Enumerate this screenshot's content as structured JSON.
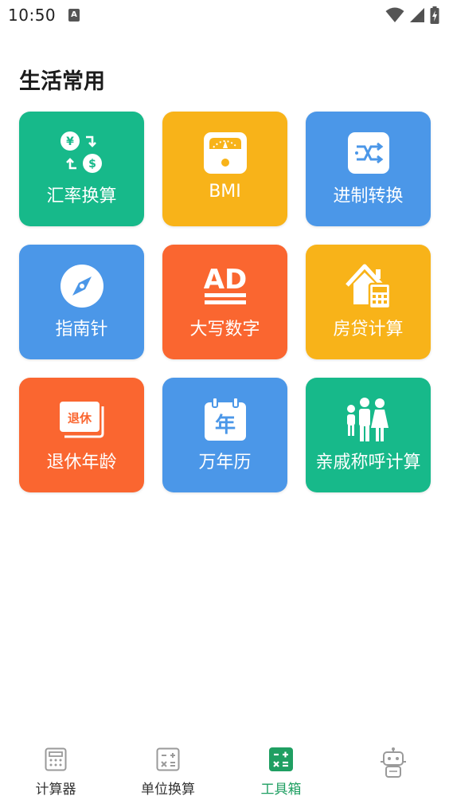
{
  "status_bar": {
    "time": "10:50",
    "notification_letter": "A"
  },
  "section": {
    "title": "生活常用"
  },
  "tools": [
    {
      "label": "汇率换算",
      "icon": "currency-exchange-icon",
      "color": "#17b98a"
    },
    {
      "label": "BMI",
      "icon": "scale-icon",
      "color": "#f8b319"
    },
    {
      "label": "进制转换",
      "icon": "base-convert-icon",
      "color": "#4b97e8"
    },
    {
      "label": "指南针",
      "icon": "compass-icon",
      "color": "#4b97e8"
    },
    {
      "label": "大写数字",
      "icon": "ad-uppercase-icon",
      "color": "#fa6630"
    },
    {
      "label": "房贷计算",
      "icon": "house-calculator-icon",
      "color": "#f8b319"
    },
    {
      "label": "退休年龄",
      "icon": "retirement-card-icon",
      "color": "#fa6630",
      "icon_text": "退休"
    },
    {
      "label": "万年历",
      "icon": "calendar-icon",
      "color": "#4b97e8",
      "icon_text": "年"
    },
    {
      "label": "亲戚称呼计算",
      "icon": "family-icon",
      "color": "#17b98a"
    }
  ],
  "bottom_nav": [
    {
      "label": "计算器",
      "icon": "calculator-icon",
      "active": false
    },
    {
      "label": "单位换算",
      "icon": "unit-convert-icon",
      "active": false
    },
    {
      "label": "工具箱",
      "icon": "toolbox-icon",
      "active": true
    },
    {
      "label": "",
      "icon": "robot-icon",
      "active": false
    }
  ],
  "colors": {
    "active_nav": "#1f9f62",
    "inactive_nav": "#9a9a9a"
  }
}
